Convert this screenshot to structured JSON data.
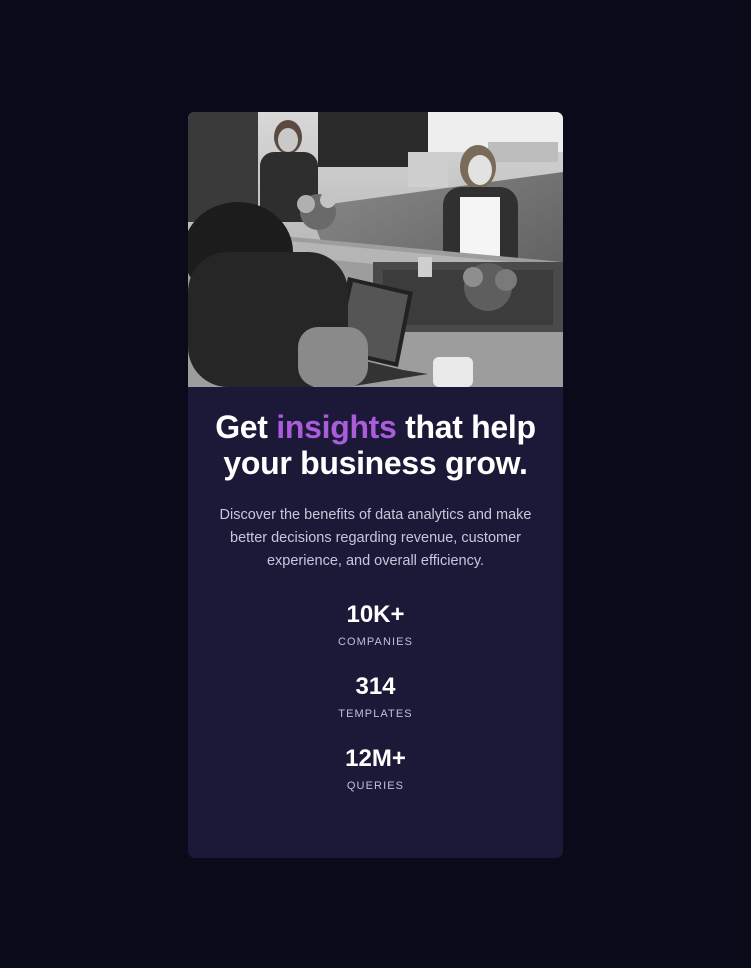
{
  "card": {
    "image_alt": "People working at a table with laptops",
    "headline": {
      "before": "Get ",
      "accent": "insights",
      "after": " that help your business grow."
    },
    "description": "Discover the benefits of data analytics and make better decisions regarding revenue, customer experience, and overall efficiency.",
    "stats": [
      {
        "value": "10K+",
        "label": "COMPANIES"
      },
      {
        "value": "314",
        "label": "TEMPLATES"
      },
      {
        "value": "12M+",
        "label": "QUERIES"
      }
    ]
  },
  "colors": {
    "page_background": "#090b1a",
    "card_background": "#1b1937",
    "accent": "#aa5cdb",
    "text_primary": "#ffffff",
    "text_secondary": "#c9c6dc"
  }
}
